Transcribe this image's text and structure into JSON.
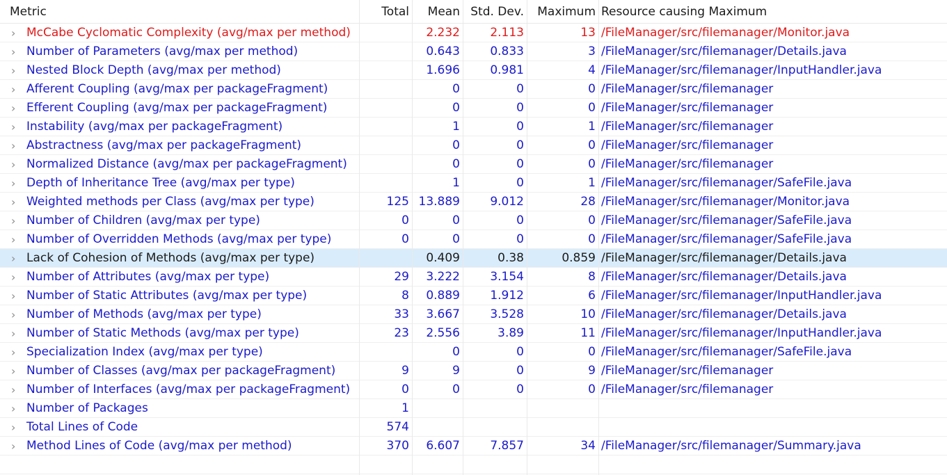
{
  "header": {
    "metric": "Metric",
    "total": "Total",
    "mean": "Mean",
    "std": "Std. Dev.",
    "max": "Maximum",
    "resource": "Resource causing Maximum"
  },
  "chevron": "›",
  "rows": [
    {
      "metric": "McCabe Cyclomatic Complexity (avg/max per method)",
      "total": "",
      "mean": "2.232",
      "std": "2.113",
      "max": "13",
      "resource": "/FileManager/src/filemanager/Monitor.java",
      "style": "warn"
    },
    {
      "metric": "Number of Parameters (avg/max per method)",
      "total": "",
      "mean": "0.643",
      "std": "0.833",
      "max": "3",
      "resource": "/FileManager/src/filemanager/Details.java"
    },
    {
      "metric": "Nested Block Depth (avg/max per method)",
      "total": "",
      "mean": "1.696",
      "std": "0.981",
      "max": "4",
      "resource": "/FileManager/src/filemanager/InputHandler.java"
    },
    {
      "metric": "Afferent Coupling (avg/max per packageFragment)",
      "total": "",
      "mean": "0",
      "std": "0",
      "max": "0",
      "resource": "/FileManager/src/filemanager"
    },
    {
      "metric": "Efferent Coupling (avg/max per packageFragment)",
      "total": "",
      "mean": "0",
      "std": "0",
      "max": "0",
      "resource": "/FileManager/src/filemanager"
    },
    {
      "metric": "Instability (avg/max per packageFragment)",
      "total": "",
      "mean": "1",
      "std": "0",
      "max": "1",
      "resource": "/FileManager/src/filemanager"
    },
    {
      "metric": "Abstractness (avg/max per packageFragment)",
      "total": "",
      "mean": "0",
      "std": "0",
      "max": "0",
      "resource": "/FileManager/src/filemanager"
    },
    {
      "metric": "Normalized Distance (avg/max per packageFragment)",
      "total": "",
      "mean": "0",
      "std": "0",
      "max": "0",
      "resource": "/FileManager/src/filemanager"
    },
    {
      "metric": "Depth of Inheritance Tree (avg/max per type)",
      "total": "",
      "mean": "1",
      "std": "0",
      "max": "1",
      "resource": "/FileManager/src/filemanager/SafeFile.java"
    },
    {
      "metric": "Weighted methods per Class (avg/max per type)",
      "total": "125",
      "mean": "13.889",
      "std": "9.012",
      "max": "28",
      "resource": "/FileManager/src/filemanager/Monitor.java"
    },
    {
      "metric": "Number of Children (avg/max per type)",
      "total": "0",
      "mean": "0",
      "std": "0",
      "max": "0",
      "resource": "/FileManager/src/filemanager/SafeFile.java"
    },
    {
      "metric": "Number of Overridden Methods (avg/max per type)",
      "total": "0",
      "mean": "0",
      "std": "0",
      "max": "0",
      "resource": "/FileManager/src/filemanager/SafeFile.java"
    },
    {
      "metric": "Lack of Cohesion of Methods (avg/max per type)",
      "total": "",
      "mean": "0.409",
      "std": "0.38",
      "max": "0.859",
      "resource": "/FileManager/src/filemanager/Details.java",
      "style": "selected"
    },
    {
      "metric": "Number of Attributes (avg/max per type)",
      "total": "29",
      "mean": "3.222",
      "std": "3.154",
      "max": "8",
      "resource": "/FileManager/src/filemanager/Details.java"
    },
    {
      "metric": "Number of Static Attributes (avg/max per type)",
      "total": "8",
      "mean": "0.889",
      "std": "1.912",
      "max": "6",
      "resource": "/FileManager/src/filemanager/InputHandler.java"
    },
    {
      "metric": "Number of Methods (avg/max per type)",
      "total": "33",
      "mean": "3.667",
      "std": "3.528",
      "max": "10",
      "resource": "/FileManager/src/filemanager/Details.java"
    },
    {
      "metric": "Number of Static Methods (avg/max per type)",
      "total": "23",
      "mean": "2.556",
      "std": "3.89",
      "max": "11",
      "resource": "/FileManager/src/filemanager/InputHandler.java"
    },
    {
      "metric": "Specialization Index (avg/max per type)",
      "total": "",
      "mean": "0",
      "std": "0",
      "max": "0",
      "resource": "/FileManager/src/filemanager/SafeFile.java"
    },
    {
      "metric": "Number of Classes (avg/max per packageFragment)",
      "total": "9",
      "mean": "9",
      "std": "0",
      "max": "9",
      "resource": "/FileManager/src/filemanager"
    },
    {
      "metric": "Number of Interfaces (avg/max per packageFragment)",
      "total": "0",
      "mean": "0",
      "std": "0",
      "max": "0",
      "resource": "/FileManager/src/filemanager"
    },
    {
      "metric": "Number of Packages",
      "total": "1",
      "mean": "",
      "std": "",
      "max": "",
      "resource": ""
    },
    {
      "metric": "Total Lines of Code",
      "total": "574",
      "mean": "",
      "std": "",
      "max": "",
      "resource": ""
    },
    {
      "metric": "Method Lines of Code (avg/max per method)",
      "total": "370",
      "mean": "6.607",
      "std": "7.857",
      "max": "34",
      "resource": "/FileManager/src/filemanager/Summary.java"
    }
  ]
}
